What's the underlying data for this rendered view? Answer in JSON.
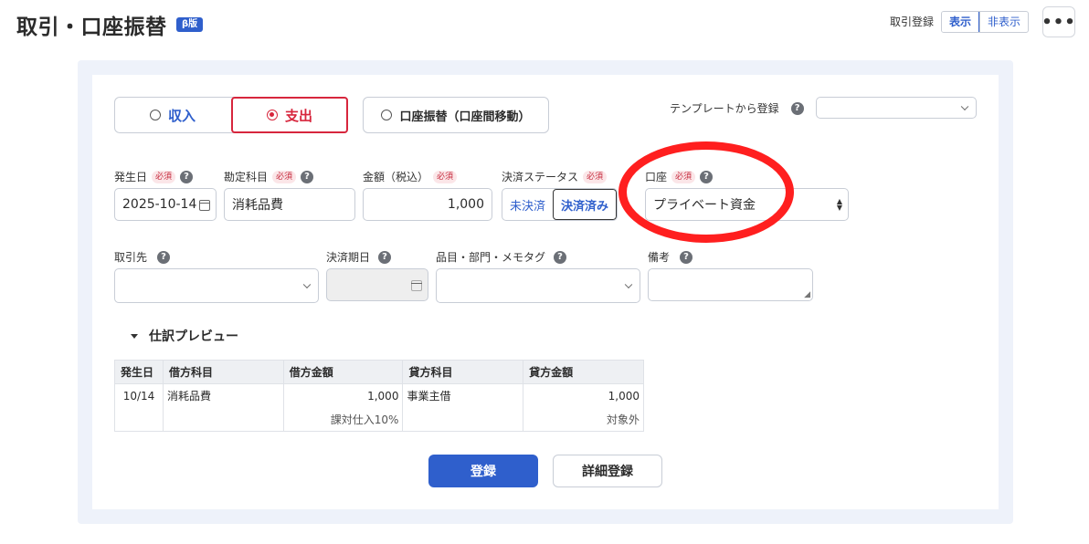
{
  "header": {
    "title": "取引・口座振替",
    "badge": "β版",
    "register_label": "取引登録",
    "show": "表示",
    "hide": "非表示",
    "more": "•••"
  },
  "type": {
    "income": "収入",
    "expense": "支出",
    "transfer": "口座振替（口座間移動）",
    "selected": "expense"
  },
  "template": {
    "label": "テンプレートから登録",
    "value": ""
  },
  "help": "?",
  "required": "必須",
  "fields": {
    "date": {
      "label": "発生日",
      "value": "2025-10-14"
    },
    "account_item": {
      "label": "勘定科目",
      "value": "消耗品費"
    },
    "amount": {
      "label": "金額（税込）",
      "value": "1,000"
    },
    "status": {
      "label": "決済ステータス",
      "unsettled": "未決済",
      "settled": "決済済み"
    },
    "wallet": {
      "label": "口座",
      "value": "プライベート資金"
    },
    "partner": {
      "label": "取引先",
      "value": ""
    },
    "due_date": {
      "label": "決済期日",
      "value": ""
    },
    "tags": {
      "label": "品目・部門・メモタグ",
      "value": ""
    },
    "memo": {
      "label": "備考",
      "value": ""
    }
  },
  "preview": {
    "title": "仕訳プレビュー",
    "columns": [
      "発生日",
      "借方科目",
      "借方金額",
      "貸方科目",
      "貸方金額"
    ],
    "row": {
      "date": "10/14",
      "debit_item": "消耗品費",
      "debit_amount": "1,000",
      "credit_item": "事業主借",
      "credit_amount": "1,000",
      "debit_tax": "課対仕入10%",
      "credit_tax": "対象外"
    }
  },
  "buttons": {
    "register": "登録",
    "detail": "詳細登録"
  },
  "colors": {
    "primary": "#2f5fcc",
    "expense": "#d7263d",
    "annotation": "#ff1f1f"
  }
}
